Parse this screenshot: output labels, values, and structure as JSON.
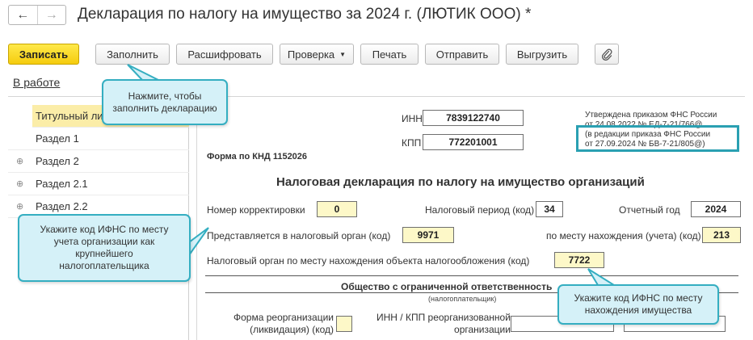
{
  "header": {
    "back_glyph": "←",
    "forward_glyph": "→",
    "title": "Декларация по налогу на имущество за 2024 г. (ЛЮТИК ООО) *"
  },
  "toolbar": {
    "save": "Записать",
    "fill": "Заполнить",
    "decode": "Расшифровать",
    "check": "Проверка",
    "print": "Печать",
    "send": "Отправить",
    "export": "Выгрузить",
    "attach_icon": "paperclip-icon"
  },
  "status": "В работе",
  "sidebar": {
    "items": [
      {
        "label": "Титульный лист",
        "expandable": false
      },
      {
        "label": "Раздел 1",
        "expandable": false
      },
      {
        "label": "Раздел 2",
        "expandable": true
      },
      {
        "label": "Раздел 2.1",
        "expandable": true
      },
      {
        "label": "Раздел 2.2",
        "expandable": true
      }
    ]
  },
  "form": {
    "inn_label": "ИНН",
    "inn_value": "7839122740",
    "kpp_label": "КПП",
    "kpp_value": "772201001",
    "approved_line1": "Утверждена приказом ФНС России",
    "approved_line2": "от 24.08.2022 № ЕД-7-21/766@",
    "edition_line1": "(в редакции приказа ФНС России",
    "edition_line2": "от 27.09.2024 № БВ-7-21/805@)",
    "form_knd": "Форма по КНД 1152026",
    "doc_title": "Налоговая декларация по налогу на имущество организаций",
    "correction_label": "Номер корректировки",
    "correction_value": "0",
    "period_label": "Налоговый период (код)",
    "period_value": "34",
    "year_label": "Отчетный год",
    "year_value": "2024",
    "tax_authority_label": "Представляется в налоговый орган (код)",
    "tax_authority_value": "9971",
    "location_label": "по месту нахождения (учета) (код)",
    "location_value": "213",
    "property_authority_label": "Налоговый орган по месту нахождения объекта налогообложения (код)",
    "property_authority_value": "7722",
    "org_name": "Общество с ограниченной ответственность",
    "org_caption": "(налогоплательщик)",
    "reorg_label_1": "Форма реорганизации",
    "reorg_label_2": "(ликвидация) (код)",
    "reorg_inn_label_1": "ИНН / КПП реорганизованной",
    "reorg_inn_label_2": "организации"
  },
  "callouts": {
    "fill_hint_1": "Нажмите, чтобы",
    "fill_hint_2": "заполнить декларацию",
    "ifns_hint_1": "Укажите код ИФНС по месту",
    "ifns_hint_2": "учета организации как",
    "ifns_hint_3": "крупнейшего",
    "ifns_hint_4": "налогоплательщика",
    "property_hint_1": "Укажите код ИФНС по месту",
    "property_hint_2": "нахождения имущества"
  },
  "colors": {
    "accent": "#34aec1",
    "callout_bg": "#d5f1f8",
    "primary_button": "#f5cc0e",
    "field_yellow": "#fdf8c8",
    "selected_item": "#fbeda8"
  }
}
